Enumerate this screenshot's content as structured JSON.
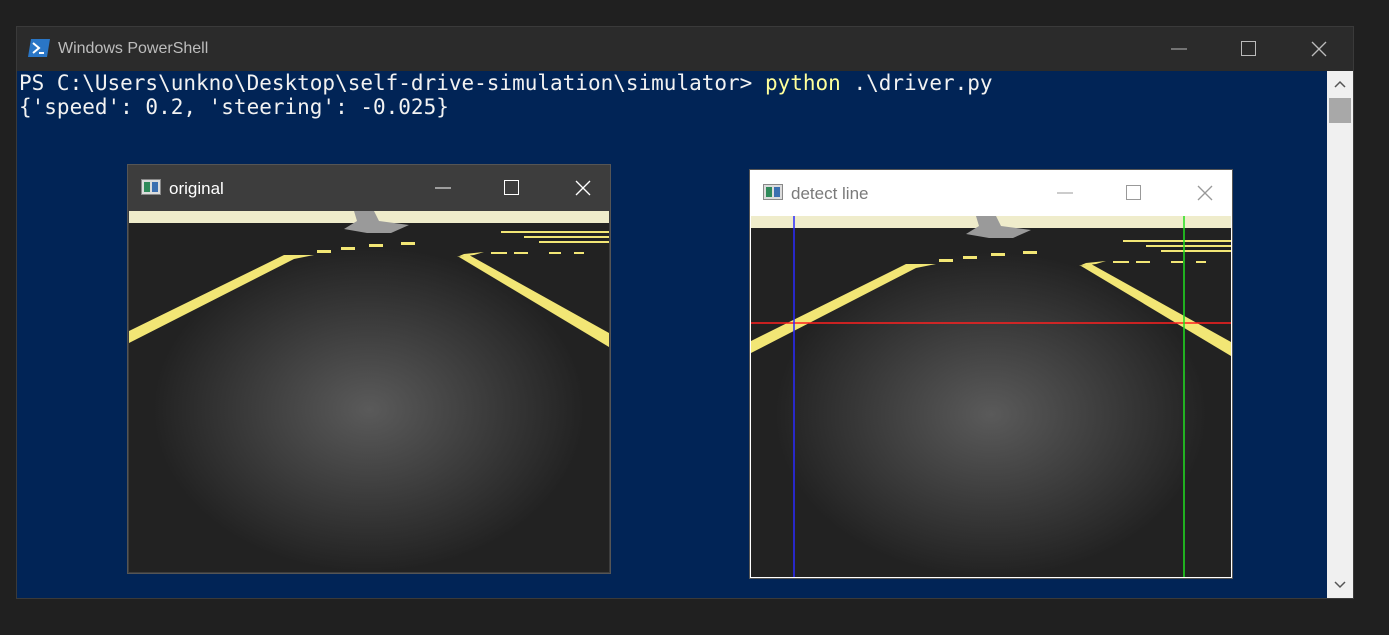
{
  "powershell": {
    "title": "Windows PowerShell",
    "prompt": "PS C:\\Users\\unkno\\Desktop\\self-drive-simulation\\simulator> ",
    "command": "python",
    "args": " .\\driver.py",
    "output": "{'speed': 0.2, 'steering': -0.025}"
  },
  "windows": {
    "original": {
      "title": "original"
    },
    "detect": {
      "title": "detect line"
    }
  },
  "colors": {
    "ps_background": "#012456",
    "lane_yellow": "#f2e675",
    "road": "#262626",
    "detect_horizontal": "#ff2020",
    "detect_left": "#2a2aff",
    "detect_right": "#20e020"
  }
}
